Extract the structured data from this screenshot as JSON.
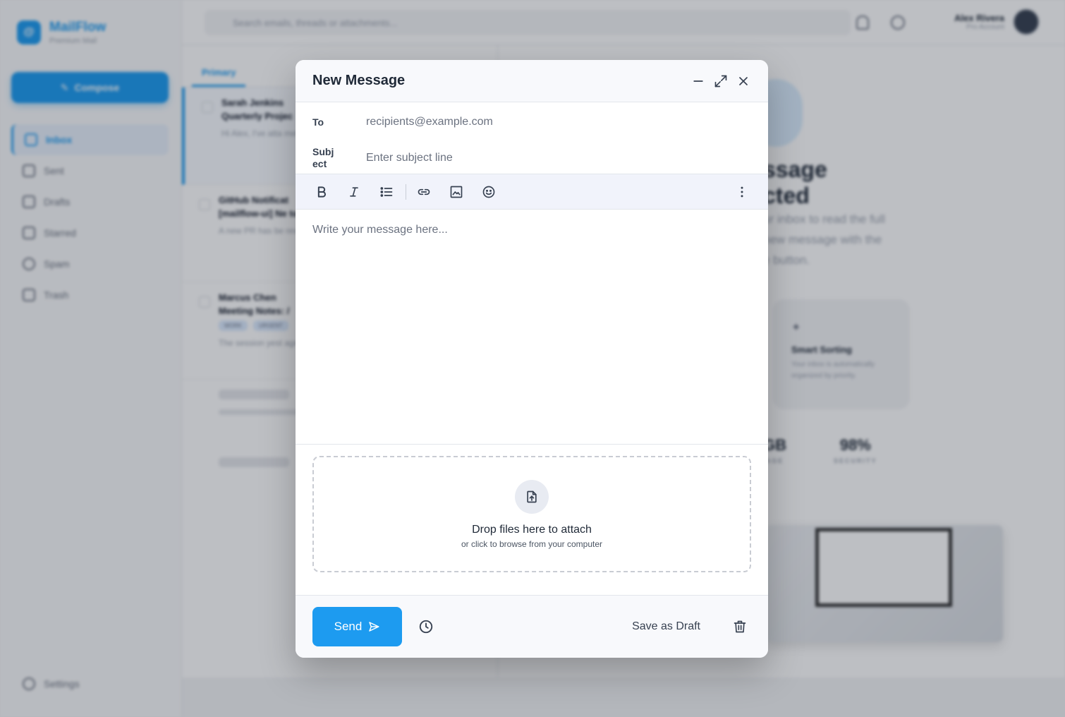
{
  "app": {
    "brand_name": "MailFlow",
    "brand_sub": "Premium Mail",
    "compose_label": "Compose",
    "nav": [
      "Inbox",
      "Sent",
      "Drafts",
      "Starred",
      "Spam",
      "Trash"
    ],
    "settings_label": "Settings",
    "search_placeholder": "Search emails, threads or attachments...",
    "user_name": "Alex Rivera",
    "user_sub": "Pro Account",
    "tabs": [
      "Primary"
    ],
    "emails": [
      {
        "from": "Sarah Jenkins",
        "subject": "Quarterly Projec",
        "snippet": "Hi Alex, I've atta metrics for the N"
      },
      {
        "from": "GitHub Notificat",
        "subject": "[mailflow-ui] Ne tokens",
        "snippet": "A new PR has be review the chang"
      },
      {
        "from": "Marcus Chen",
        "subject": "Meeting Notes: /",
        "snippet": "The session yest agreed on the RI",
        "tags": [
          "WORK",
          "URGENT"
        ]
      }
    ],
    "reader": {
      "title_line1": "ssage",
      "title_line2": "cted",
      "text_line1": "ur inbox to read the full",
      "text_line2": "new message with the",
      "text_line3": "e button.",
      "card_title": "Smart Sorting",
      "card_desc": "Your inbox is automatically organized by priority.",
      "stat1_value": "GB",
      "stat1_label": "AGE",
      "stat2_value": "98%",
      "stat2_label": "SECURITY"
    }
  },
  "modal": {
    "title": "New Message",
    "to_label": "To",
    "to_placeholder": "recipients@example.com",
    "subject_label": "Subj ect",
    "subject_placeholder": "Enter subject line",
    "body_placeholder": "Write your message here...",
    "drop_title": "Drop files here to attach",
    "drop_sub": "or click to browse from your computer",
    "send_label": "Send",
    "draft_label": "Save as Draft",
    "accent": "#1d9bf0"
  }
}
